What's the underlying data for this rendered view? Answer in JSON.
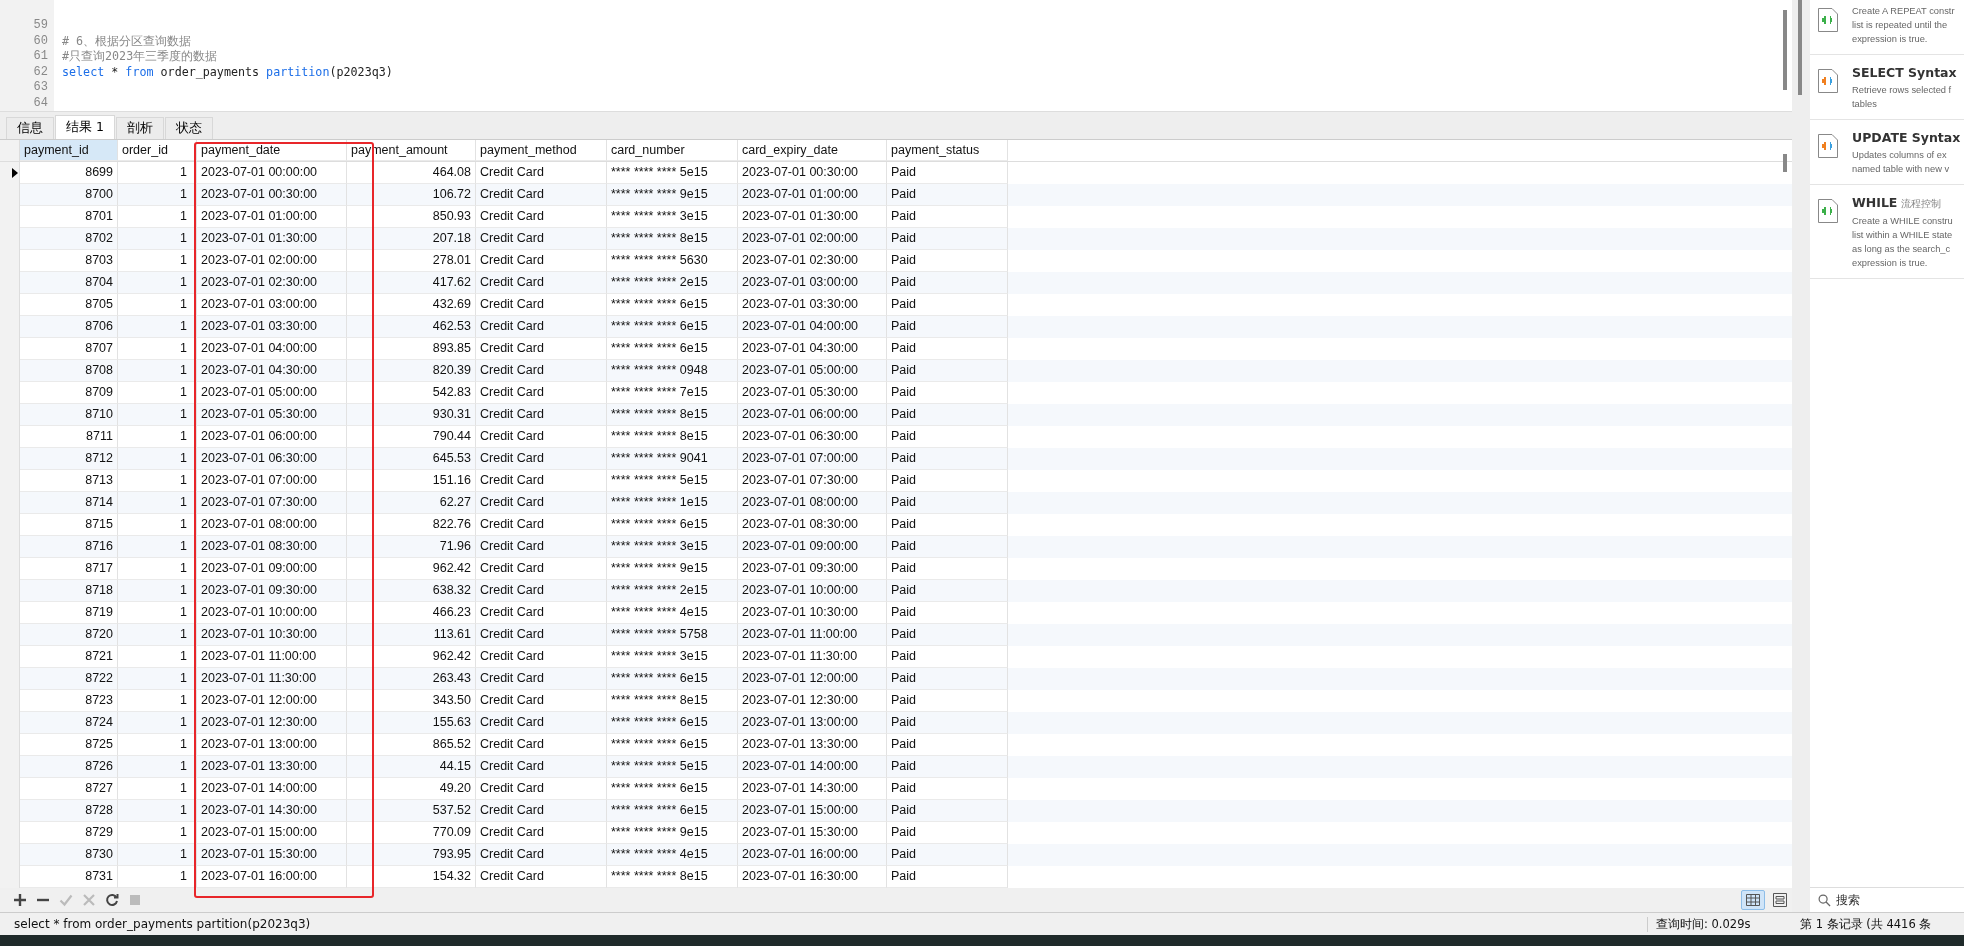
{
  "editor": {
    "lines": [
      {
        "number": "59"
      },
      {
        "number": "60",
        "tokens": [
          {
            "kind": "comment",
            "text": "# 6、根据分区查询数据"
          }
        ]
      },
      {
        "number": "61",
        "tokens": [
          {
            "kind": "comment",
            "text": "#只查询2023年三季度的数据"
          }
        ]
      },
      {
        "number": "62",
        "tokens": [
          {
            "kind": "keyword",
            "text": "select"
          },
          {
            "kind": "plain",
            "text": " * "
          },
          {
            "kind": "keyword",
            "text": "from"
          },
          {
            "kind": "plain",
            "text": " order_payments "
          },
          {
            "kind": "keyword",
            "text": "partition"
          },
          {
            "kind": "plain",
            "text": "(p2023q3)"
          }
        ]
      },
      {
        "number": "63"
      },
      {
        "number": "64"
      }
    ]
  },
  "tabs": [
    {
      "label": "信息",
      "selected": false
    },
    {
      "label": "结果 1",
      "selected": true
    },
    {
      "label": "剖析",
      "selected": false
    },
    {
      "label": "状态",
      "selected": false
    }
  ],
  "table": {
    "columns": [
      {
        "label": "payment_id",
        "selected": true
      },
      {
        "label": "order_id",
        "selected": false
      },
      {
        "label": "payment_date",
        "selected": false
      },
      {
        "label": "payment_amount",
        "selected": false
      },
      {
        "label": "payment_method",
        "selected": false
      },
      {
        "label": "card_number",
        "selected": false
      },
      {
        "label": "card_expiry_date",
        "selected": false
      },
      {
        "label": "payment_status",
        "selected": false
      }
    ],
    "rows": [
      {
        "current": true,
        "cells": [
          "8699",
          "1",
          "2023-07-01 00:00:00",
          "464.08",
          "Credit Card",
          "**** **** **** 5e15",
          "2023-07-01 00:30:00",
          "Paid"
        ]
      },
      {
        "current": false,
        "cells": [
          "8700",
          "1",
          "2023-07-01 00:30:00",
          "106.72",
          "Credit Card",
          "**** **** **** 9e15",
          "2023-07-01 01:00:00",
          "Paid"
        ]
      },
      {
        "current": false,
        "cells": [
          "8701",
          "1",
          "2023-07-01 01:00:00",
          "850.93",
          "Credit Card",
          "**** **** **** 3e15",
          "2023-07-01 01:30:00",
          "Paid"
        ]
      },
      {
        "current": false,
        "cells": [
          "8702",
          "1",
          "2023-07-01 01:30:00",
          "207.18",
          "Credit Card",
          "**** **** **** 8e15",
          "2023-07-01 02:00:00",
          "Paid"
        ]
      },
      {
        "current": false,
        "cells": [
          "8703",
          "1",
          "2023-07-01 02:00:00",
          "278.01",
          "Credit Card",
          "**** **** **** 5630",
          "2023-07-01 02:30:00",
          "Paid"
        ]
      },
      {
        "current": false,
        "cells": [
          "8704",
          "1",
          "2023-07-01 02:30:00",
          "417.62",
          "Credit Card",
          "**** **** **** 2e15",
          "2023-07-01 03:00:00",
          "Paid"
        ]
      },
      {
        "current": false,
        "cells": [
          "8705",
          "1",
          "2023-07-01 03:00:00",
          "432.69",
          "Credit Card",
          "**** **** **** 6e15",
          "2023-07-01 03:30:00",
          "Paid"
        ]
      },
      {
        "current": false,
        "cells": [
          "8706",
          "1",
          "2023-07-01 03:30:00",
          "462.53",
          "Credit Card",
          "**** **** **** 6e15",
          "2023-07-01 04:00:00",
          "Paid"
        ]
      },
      {
        "current": false,
        "cells": [
          "8707",
          "1",
          "2023-07-01 04:00:00",
          "893.85",
          "Credit Card",
          "**** **** **** 6e15",
          "2023-07-01 04:30:00",
          "Paid"
        ]
      },
      {
        "current": false,
        "cells": [
          "8708",
          "1",
          "2023-07-01 04:30:00",
          "820.39",
          "Credit Card",
          "**** **** **** 0948",
          "2023-07-01 05:00:00",
          "Paid"
        ]
      },
      {
        "current": false,
        "cells": [
          "8709",
          "1",
          "2023-07-01 05:00:00",
          "542.83",
          "Credit Card",
          "**** **** **** 7e15",
          "2023-07-01 05:30:00",
          "Paid"
        ]
      },
      {
        "current": false,
        "cells": [
          "8710",
          "1",
          "2023-07-01 05:30:00",
          "930.31",
          "Credit Card",
          "**** **** **** 8e15",
          "2023-07-01 06:00:00",
          "Paid"
        ]
      },
      {
        "current": false,
        "cells": [
          "8711",
          "1",
          "2023-07-01 06:00:00",
          "790.44",
          "Credit Card",
          "**** **** **** 8e15",
          "2023-07-01 06:30:00",
          "Paid"
        ]
      },
      {
        "current": false,
        "cells": [
          "8712",
          "1",
          "2023-07-01 06:30:00",
          "645.53",
          "Credit Card",
          "**** **** **** 9041",
          "2023-07-01 07:00:00",
          "Paid"
        ]
      },
      {
        "current": false,
        "cells": [
          "8713",
          "1",
          "2023-07-01 07:00:00",
          "151.16",
          "Credit Card",
          "**** **** **** 5e15",
          "2023-07-01 07:30:00",
          "Paid"
        ]
      },
      {
        "current": false,
        "cells": [
          "8714",
          "1",
          "2023-07-01 07:30:00",
          "62.27",
          "Credit Card",
          "**** **** **** 1e15",
          "2023-07-01 08:00:00",
          "Paid"
        ]
      },
      {
        "current": false,
        "cells": [
          "8715",
          "1",
          "2023-07-01 08:00:00",
          "822.76",
          "Credit Card",
          "**** **** **** 6e15",
          "2023-07-01 08:30:00",
          "Paid"
        ]
      },
      {
        "current": false,
        "cells": [
          "8716",
          "1",
          "2023-07-01 08:30:00",
          "71.96",
          "Credit Card",
          "**** **** **** 3e15",
          "2023-07-01 09:00:00",
          "Paid"
        ]
      },
      {
        "current": false,
        "cells": [
          "8717",
          "1",
          "2023-07-01 09:00:00",
          "962.42",
          "Credit Card",
          "**** **** **** 9e15",
          "2023-07-01 09:30:00",
          "Paid"
        ]
      },
      {
        "current": false,
        "cells": [
          "8718",
          "1",
          "2023-07-01 09:30:00",
          "638.32",
          "Credit Card",
          "**** **** **** 2e15",
          "2023-07-01 10:00:00",
          "Paid"
        ]
      },
      {
        "current": false,
        "cells": [
          "8719",
          "1",
          "2023-07-01 10:00:00",
          "466.23",
          "Credit Card",
          "**** **** **** 4e15",
          "2023-07-01 10:30:00",
          "Paid"
        ]
      },
      {
        "current": false,
        "cells": [
          "8720",
          "1",
          "2023-07-01 10:30:00",
          "113.61",
          "Credit Card",
          "**** **** **** 5758",
          "2023-07-01 11:00:00",
          "Paid"
        ]
      },
      {
        "current": false,
        "cells": [
          "8721",
          "1",
          "2023-07-01 11:00:00",
          "962.42",
          "Credit Card",
          "**** **** **** 3e15",
          "2023-07-01 11:30:00",
          "Paid"
        ]
      },
      {
        "current": false,
        "cells": [
          "8722",
          "1",
          "2023-07-01 11:30:00",
          "263.43",
          "Credit Card",
          "**** **** **** 6e15",
          "2023-07-01 12:00:00",
          "Paid"
        ]
      },
      {
        "current": false,
        "cells": [
          "8723",
          "1",
          "2023-07-01 12:00:00",
          "343.50",
          "Credit Card",
          "**** **** **** 8e15",
          "2023-07-01 12:30:00",
          "Paid"
        ]
      },
      {
        "current": false,
        "cells": [
          "8724",
          "1",
          "2023-07-01 12:30:00",
          "155.63",
          "Credit Card",
          "**** **** **** 6e15",
          "2023-07-01 13:00:00",
          "Paid"
        ]
      },
      {
        "current": false,
        "cells": [
          "8725",
          "1",
          "2023-07-01 13:00:00",
          "865.52",
          "Credit Card",
          "**** **** **** 6e15",
          "2023-07-01 13:30:00",
          "Paid"
        ]
      },
      {
        "current": false,
        "cells": [
          "8726",
          "1",
          "2023-07-01 13:30:00",
          "44.15",
          "Credit Card",
          "**** **** **** 5e15",
          "2023-07-01 14:00:00",
          "Paid"
        ]
      },
      {
        "current": false,
        "cells": [
          "8727",
          "1",
          "2023-07-01 14:00:00",
          "49.20",
          "Credit Card",
          "**** **** **** 6e15",
          "2023-07-01 14:30:00",
          "Paid"
        ]
      },
      {
        "current": false,
        "cells": [
          "8728",
          "1",
          "2023-07-01 14:30:00",
          "537.52",
          "Credit Card",
          "**** **** **** 6e15",
          "2023-07-01 15:00:00",
          "Paid"
        ]
      },
      {
        "current": false,
        "cells": [
          "8729",
          "1",
          "2023-07-01 15:00:00",
          "770.09",
          "Credit Card",
          "**** **** **** 9e15",
          "2023-07-01 15:30:00",
          "Paid"
        ]
      },
      {
        "current": false,
        "cells": [
          "8730",
          "1",
          "2023-07-01 15:30:00",
          "793.95",
          "Credit Card",
          "**** **** **** 4e15",
          "2023-07-01 16:00:00",
          "Paid"
        ]
      },
      {
        "current": false,
        "cells": [
          "8731",
          "1",
          "2023-07-01 16:00:00",
          "154.32",
          "Credit Card",
          "**** **** **** 8e15",
          "2023-07-01 16:30:00",
          "Paid"
        ]
      }
    ]
  },
  "toolbar": [
    {
      "kind": "add",
      "disabled": false
    },
    {
      "kind": "remove",
      "disabled": false
    },
    {
      "kind": "apply",
      "disabled": true
    },
    {
      "kind": "cancel",
      "disabled": true
    },
    {
      "kind": "refresh",
      "disabled": false
    },
    {
      "kind": "stop",
      "disabled": true
    }
  ],
  "view_modes": [
    {
      "kind": "grid",
      "selected": true
    },
    {
      "kind": "form",
      "selected": false
    }
  ],
  "snippets": [
    {
      "color": "#3cb04a",
      "description": [
        "Create A REPEAT constr",
        "list is repeated until the",
        "expression is true."
      ]
    },
    {
      "title": "SELECT Syntax",
      "color": "#f08020",
      "description": [
        "Retrieve rows selected f",
        "tables"
      ]
    },
    {
      "title": "UPDATE Syntax",
      "color": "#f08020",
      "description": [
        "Updates columns of ex",
        "named table with new v"
      ]
    },
    {
      "title": "WHILE",
      "tag": "流程控制",
      "color": "#3cb04a",
      "description": [
        "Create a WHILE constru",
        "list within a WHILE state",
        "as long as the search_c",
        "expression is true."
      ]
    }
  ],
  "snippet_search": {
    "placeholder": "搜索"
  },
  "status_bar": {
    "query": "select * from order_payments partition(p2023q3)",
    "query_time": "查询时间: 0.029s",
    "record": "第 1 条记录 (共 4416 条"
  }
}
